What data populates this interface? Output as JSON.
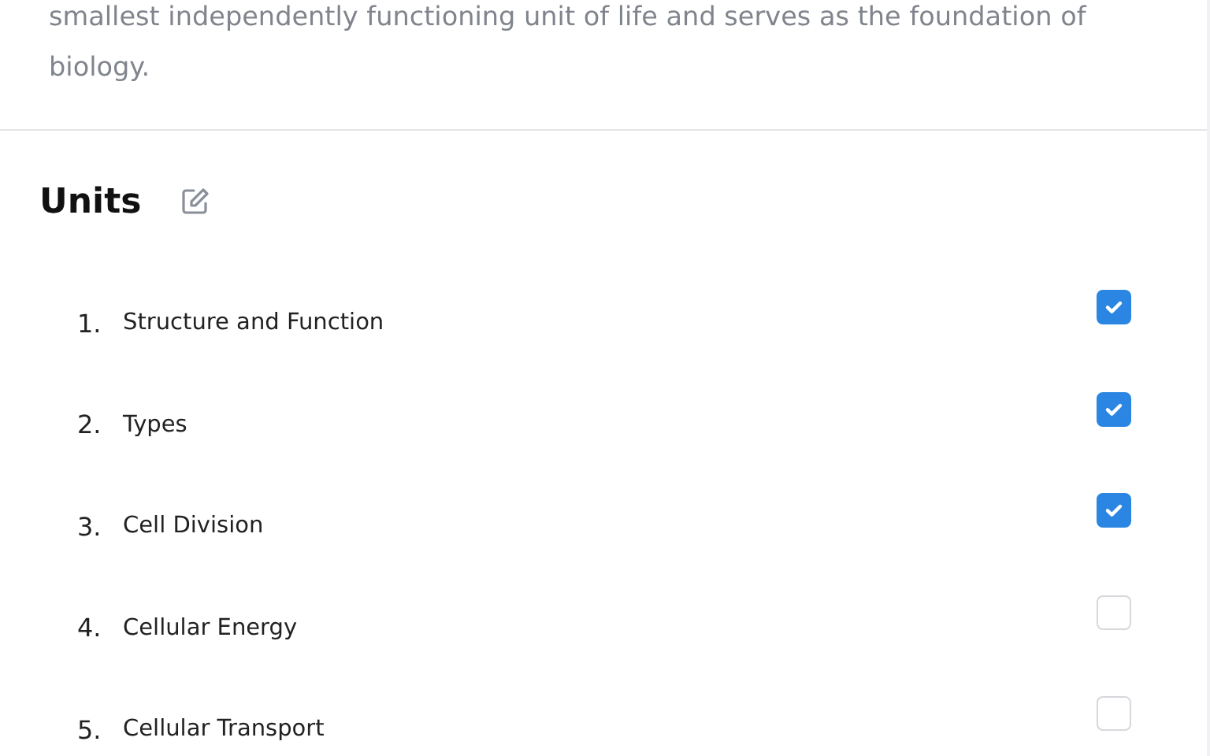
{
  "description": "smallest independently functioning unit of life and serves as the foundation of biology.",
  "units": {
    "title": "Units",
    "items": [
      {
        "number": "1.",
        "label": "Structure and Function",
        "checked": true
      },
      {
        "number": "2.",
        "label": "Types",
        "checked": true
      },
      {
        "number": "3.",
        "label": "Cell Division",
        "checked": true
      },
      {
        "number": "4.",
        "label": "Cellular Energy",
        "checked": false
      },
      {
        "number": "5.",
        "label": "Cellular Transport",
        "checked": false
      }
    ]
  }
}
